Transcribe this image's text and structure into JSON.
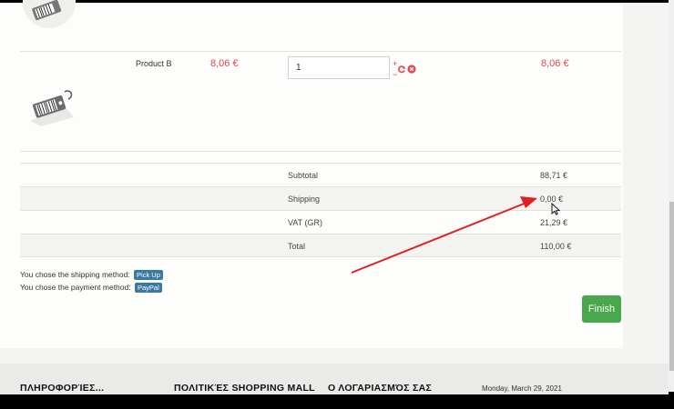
{
  "product": {
    "name": "Product B",
    "unit_price": "8,06 €",
    "quantity": "1",
    "qty_plus": "+",
    "qty_minus": "−",
    "line_total": "8,06 €"
  },
  "totals": [
    {
      "label": "Subtotal",
      "value": "88,71 €"
    },
    {
      "label": "Shipping",
      "value": "0,00 €"
    },
    {
      "label": "VAT (GR)",
      "value": "21,29 €"
    },
    {
      "label": "Total",
      "value": "110,00 €"
    }
  ],
  "methods": {
    "shipping_text": "You chose the shipping method:",
    "shipping_value": "Pick Up",
    "payment_text": "You chose the payment method:",
    "payment_value": "PayPal"
  },
  "finish_label": "Finish",
  "footer": {
    "col1": "ΠΛΗΡΟΦΟΡΊΕΣ...",
    "col2": "ΠΟΛΙΤΙΚΈΣ SHOPPING MALL",
    "col3": "Ο ΛΟΓΑΡΙΑΣΜΌΣ ΣΑΣ",
    "date": "Monday, March 29, 2021"
  },
  "colors": {
    "price": "#e0484e",
    "finish": "#49a84c",
    "badge": "#3a79a6",
    "annotation_arrow": "#e02020"
  },
  "icons": [
    "price-tag-icon",
    "refresh-icon",
    "remove-icon",
    "mouse-cursor-icon"
  ]
}
